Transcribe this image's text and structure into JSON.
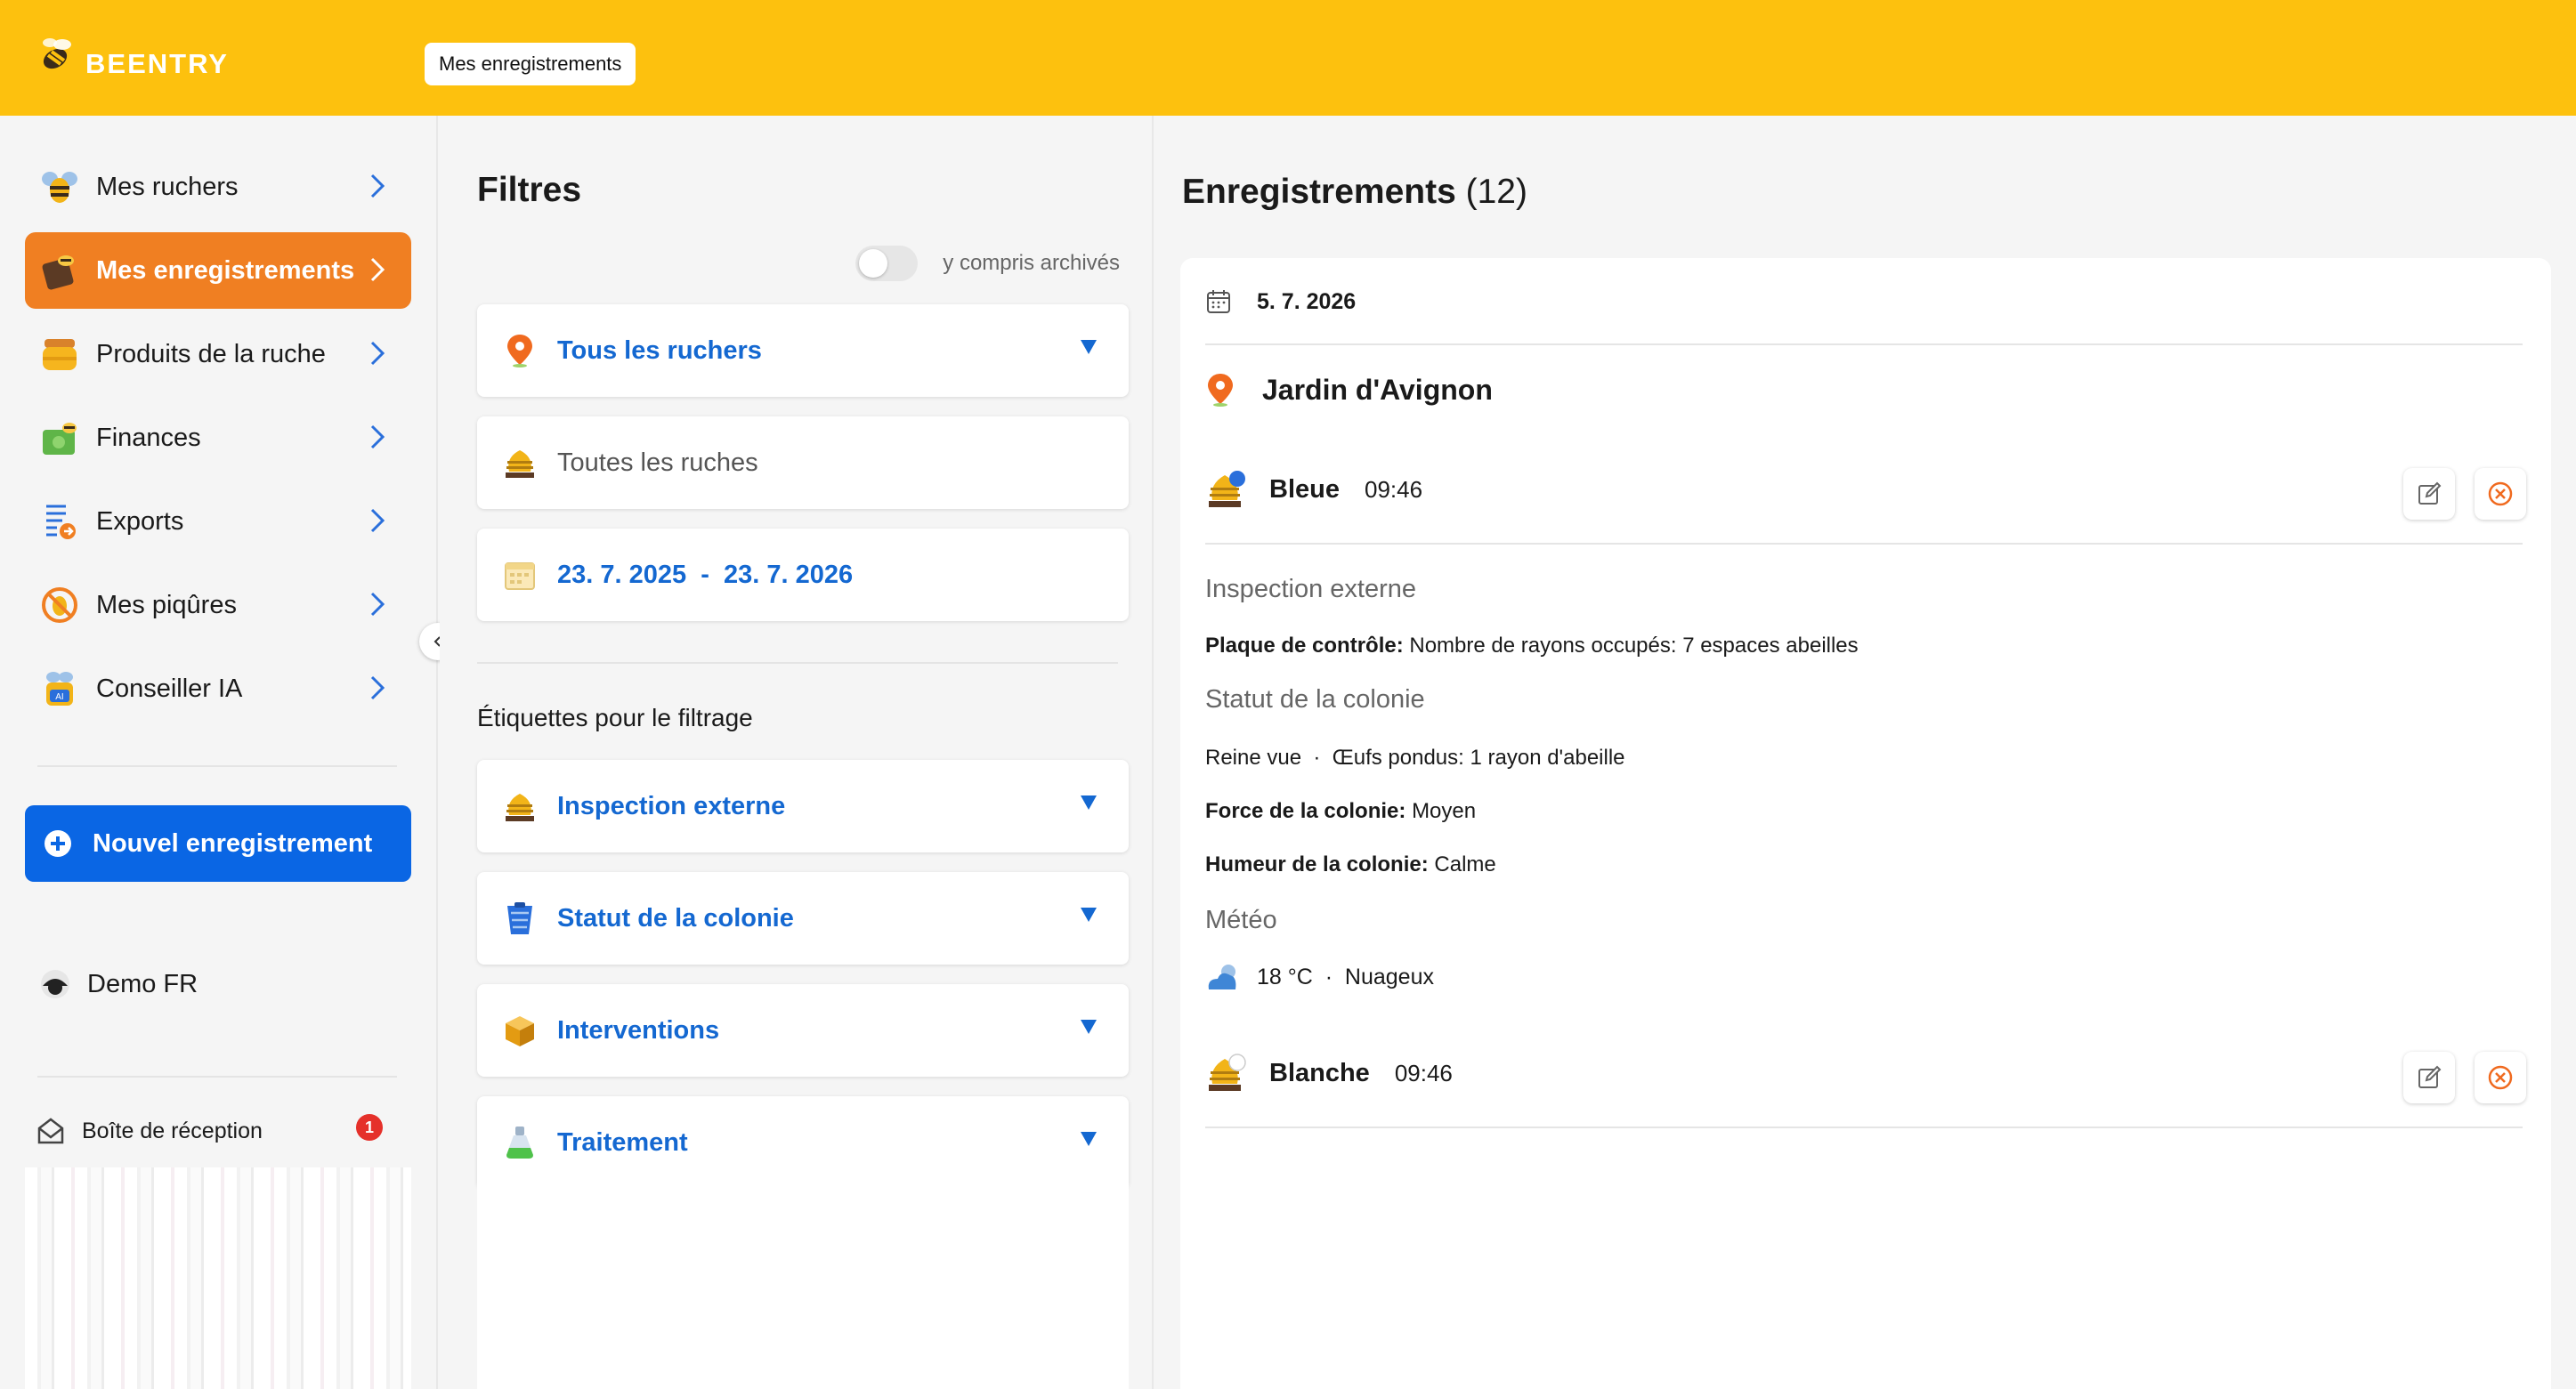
{
  "app": {
    "brand": "BEENTRY",
    "breadcrumb": "Mes enregistrements"
  },
  "sidebar": {
    "items": [
      {
        "label": "Mes ruchers",
        "icon": "bee-icon"
      },
      {
        "label": "Mes enregistrements",
        "icon": "notebook-bee-icon",
        "active": true
      },
      {
        "label": "Produits de la ruche",
        "icon": "honey-jar-icon"
      },
      {
        "label": "Finances",
        "icon": "money-icon"
      },
      {
        "label": "Exports",
        "icon": "export-icon"
      },
      {
        "label": "Mes piqûres",
        "icon": "sting-icon"
      },
      {
        "label": "Conseiller IA",
        "icon": "ai-bee-icon"
      }
    ],
    "new_record": "Nouvel enregistrement",
    "user": "Demo FR",
    "inbox": {
      "label": "Boîte de réception",
      "count": "1"
    }
  },
  "filters": {
    "title": "Filtres",
    "archived_toggle": "y compris archivés",
    "apiaries": "Tous les ruchers",
    "hives": "Toutes les ruches",
    "date_range": "23. 7. 2025  -  23. 7. 2026",
    "labels_title": "Étiquettes pour le filtrage",
    "tags": [
      {
        "label": "Inspection externe"
      },
      {
        "label": "Statut de la colonie"
      },
      {
        "label": "Interventions"
      },
      {
        "label": "Traitement"
      }
    ]
  },
  "records": {
    "title": "Enregistrements",
    "count": "(12)",
    "date": "5. 7. 2026",
    "apiary": "Jardin d'Avignon",
    "entries": [
      {
        "hive": "Bleue",
        "time": "09:46",
        "section_ext": "Inspection externe",
        "plaque_label": "Plaque de contrôle:",
        "plaque_value": "Nombre de rayons occupés: 7 espaces abeilles",
        "section_status": "Statut de la colonie",
        "queen_line": "Reine vue  ·  Œufs pondus: 1 rayon d'abeille",
        "force_label": "Force de la colonie:",
        "force_value": "Moyen",
        "mood_label": "Humeur de la colonie:",
        "mood_value": "Calme",
        "section_weather": "Météo",
        "weather": "18 °C  ·  Nuageux"
      },
      {
        "hive": "Blanche",
        "time": "09:46"
      }
    ]
  },
  "colors": {
    "brand_yellow": "#fdc10e",
    "active_orange": "#f07f22",
    "primary_blue": "#0a66e4",
    "link_blue": "#1468d1"
  }
}
